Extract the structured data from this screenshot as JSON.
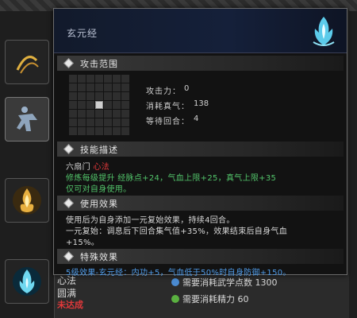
{
  "colors": {
    "green": "#52c46a",
    "blue": "#4f9be8",
    "red": "#e0383a",
    "tooltip_header": "#15203a"
  },
  "tooltip": {
    "title": "玄元经",
    "icon": "blue-flame-lotus-icon",
    "attack_range": {
      "heading": "攻击范围",
      "grid_size": 7,
      "selected_cell": "center",
      "stats": [
        {
          "label": "攻击力：",
          "value": "0"
        },
        {
          "label": "消耗真气：",
          "value": "138"
        },
        {
          "label": "等待回合：",
          "value": "4"
        }
      ]
    },
    "description": {
      "heading": "技能描述",
      "sect_prefix": "六扇门",
      "sect_name": "心法",
      "line_bonus": "修炼每级提升 经脉点+24，气血上限+25，真气上限+35",
      "line_self": "仅可对自身使用。"
    },
    "usage": {
      "heading": "使用效果",
      "line1": "使用后为自身添加一元复始效果，持续4回合。",
      "line2": "一元复始：调息后下回合集气值+35%，效果结束后自身气血",
      "line3": "+15%。"
    },
    "special": {
      "heading": "特殊效果",
      "line1": "5级效果-玄元经：内功+5，气血低于50%时自身防御+150。"
    }
  },
  "background": {
    "left_text_1": "心法",
    "left_text_2": "圆满",
    "left_text_3": "未达成",
    "req_1": "需要消耗武学点数 1300",
    "req_2": "需要消耗精力 60"
  }
}
